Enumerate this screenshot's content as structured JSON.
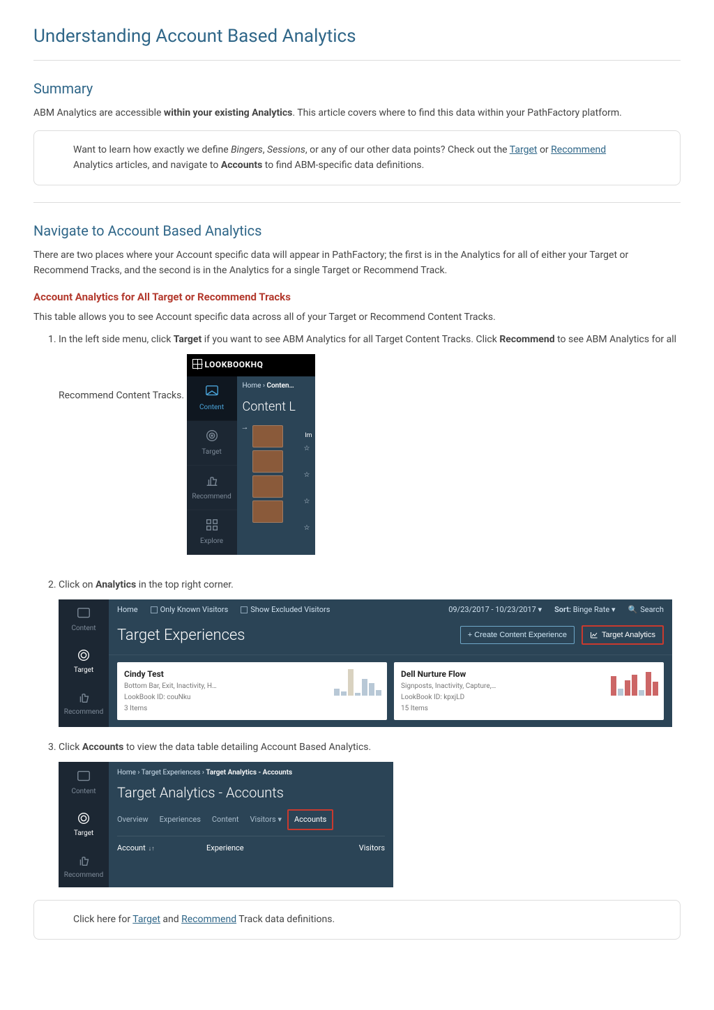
{
  "page": {
    "title": "Understanding Account Based Analytics"
  },
  "summary": {
    "heading": "Summary",
    "intro_pre": "ABM Analytics are accessible ",
    "intro_bold": "within your existing Analytics",
    "intro_post": ". This article covers where to find this data within your PathFactory platform.",
    "callout_pre": "Want to learn how exactly we define ",
    "callout_em1": "Bingers",
    "callout_sep": ", ",
    "callout_em2": "Sessions",
    "callout_mid": ", or any of our other data points? Check out the ",
    "callout_link1": "Target",
    "callout_or": " or ",
    "callout_link2": "Recommend",
    "callout_post": " Analytics articles, and navigate to ",
    "callout_bold": "Accounts",
    "callout_end": " to find ABM-specific data definitions."
  },
  "navigate": {
    "heading": "Navigate to Account Based Analytics",
    "intro": "There are two places where your Account specific data will appear in PathFactory; the first is in the Analytics for all of either your Target or Recommend Tracks, and the second is in the Analytics for a single Target or Recommend Track.",
    "sub_heading": "Account Analytics for All Target or Recommend Tracks",
    "sub_intro": "This table allows you to see Account specific data across all of your Target or Recommend Content Tracks.",
    "step1_pre": "In the left side menu, click ",
    "step1_b1": "Target",
    "step1_mid": " if you want to see ABM Analytics for all Target Content Tracks. Click ",
    "step1_b2": "Recommend",
    "step1_post": " to see ABM Analytics for all Recommend Content Tracks.",
    "step2_pre": "Click on ",
    "step2_b": "Analytics",
    "step2_post": " in the top right corner.",
    "step3_pre": "Click ",
    "step3_b": "Accounts",
    "step3_post": " to view the data table detailing Account Based Analytics."
  },
  "ss1": {
    "logo": "LOOKBOOKHQ",
    "crumb_home": "Home",
    "crumb_sep": " › ",
    "crumb_cur": "Conten…",
    "heading": "Content L",
    "im": "Im",
    "rail": {
      "content": "Content",
      "target": "Target",
      "recommend": "Recommend",
      "explore": "Explore"
    }
  },
  "ss2": {
    "toolbar": {
      "home": "Home",
      "only_known": "Only Known Visitors",
      "show_excluded": "Show Excluded Visitors",
      "date_range": "09/23/2017 - 10/23/2017",
      "sort_label": "Sort:",
      "sort_value": "Binge Rate",
      "search": "Search"
    },
    "title": "Target Experiences",
    "btn_create": "+  Create Content Experience",
    "btn_analytics": "Target Analytics",
    "rail": {
      "content": "Content",
      "target": "Target",
      "recommend": "Recommend"
    },
    "card1": {
      "title": "Cindy Test",
      "l1": "Bottom Bar, Exit, Inactivity, H…",
      "l2": "LookBook ID: couNku",
      "l3": "3 Items"
    },
    "card2": {
      "title": "Dell Nurture Flow",
      "l1": "Signposts, Inactivity, Capture,…",
      "l2": "LookBook ID: kpxjLD",
      "l3": "15 Items"
    }
  },
  "ss3": {
    "crumb": {
      "home": "Home",
      "sep": " › ",
      "t1": "Target Experiences",
      "t2": "Target Analytics - Accounts"
    },
    "heading": "Target Analytics - Accounts",
    "tabs": {
      "overview": "Overview",
      "experiences": "Experiences",
      "content": "Content",
      "visitors": "Visitors",
      "accounts": "Accounts"
    },
    "cols": {
      "account": "Account",
      "experience": "Experience",
      "visitors": "Visitors"
    },
    "rail": {
      "content": "Content",
      "target": "Target",
      "recommend": "Recommend"
    }
  },
  "footer_callout": {
    "pre": "Click here for ",
    "link1": "Target",
    "and": " and ",
    "link2": "Recommend",
    "post": " Track data definitions."
  }
}
